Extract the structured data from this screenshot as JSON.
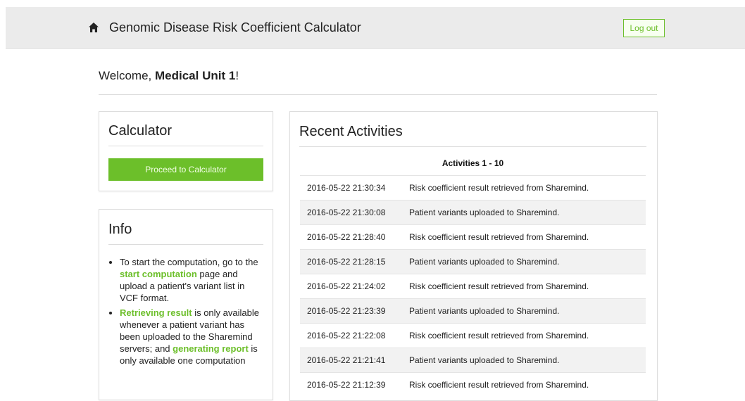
{
  "header": {
    "title": "Genomic Disease Risk Coefficient Calculator",
    "home_icon": "home-icon",
    "logout_label": "Log out",
    "accent_color": "#6cbf2a"
  },
  "welcome": {
    "prefix": "Welcome, ",
    "user": "Medical Unit 1",
    "suffix": "!"
  },
  "calculator": {
    "title": "Calculator",
    "button_label": "Proceed to Calculator"
  },
  "info": {
    "title": "Info",
    "item1": {
      "before": "To start the computation, go to the ",
      "link": "start computation",
      "after": " page and upload a patient's variant list in VCF format."
    },
    "item2": {
      "link1": "Retrieving result",
      "middle": " is only available whenever a patient variant has been uploaded to the Sharemind servers; and ",
      "link2": "generating report",
      "after": " is only available one computation"
    }
  },
  "activities": {
    "title": "Recent Activities",
    "caption": "Activities 1 - 10",
    "rows": [
      {
        "time": "2016-05-22 21:30:34",
        "text": "Risk coefficient result retrieved from Sharemind."
      },
      {
        "time": "2016-05-22 21:30:08",
        "text": "Patient variants uploaded to Sharemind."
      },
      {
        "time": "2016-05-22 21:28:40",
        "text": "Risk coefficient result retrieved from Sharemind."
      },
      {
        "time": "2016-05-22 21:28:15",
        "text": "Patient variants uploaded to Sharemind."
      },
      {
        "time": "2016-05-22 21:24:02",
        "text": "Risk coefficient result retrieved from Sharemind."
      },
      {
        "time": "2016-05-22 21:23:39",
        "text": "Patient variants uploaded to Sharemind."
      },
      {
        "time": "2016-05-22 21:22:08",
        "text": "Risk coefficient result retrieved from Sharemind."
      },
      {
        "time": "2016-05-22 21:21:41",
        "text": "Patient variants uploaded to Sharemind."
      },
      {
        "time": "2016-05-22 21:12:39",
        "text": "Risk coefficient result retrieved from Sharemind."
      }
    ]
  }
}
